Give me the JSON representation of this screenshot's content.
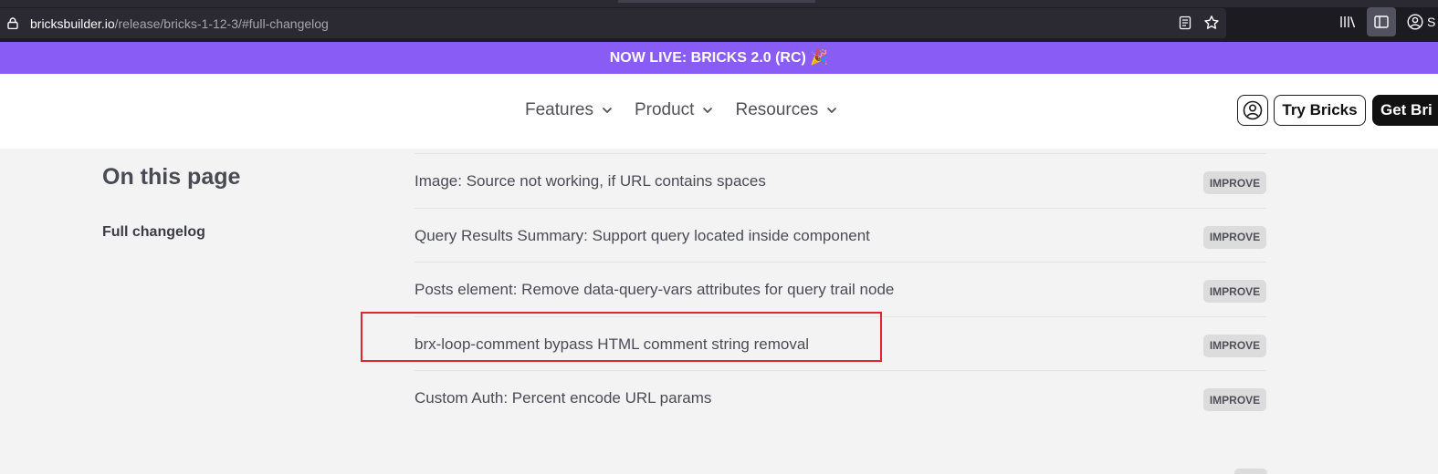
{
  "browser": {
    "url_domain": "bricksbuilder.io",
    "url_path": "/release/bricks-1-12-3/#full-changelog",
    "account_label": "S"
  },
  "announcement": {
    "text": "NOW LIVE: BRICKS 2.0 (RC) 🎉"
  },
  "nav": {
    "items": [
      {
        "label": "Features"
      },
      {
        "label": "Product"
      },
      {
        "label": "Resources"
      }
    ],
    "try_label": "Try Bricks",
    "get_label": "Get Bri"
  },
  "toc": {
    "title": "On this page",
    "link": "Full changelog"
  },
  "changelog": {
    "rows": [
      {
        "text": "Image: Source not working, if URL contains spaces",
        "badge": "IMPROVE"
      },
      {
        "text": "Query Results Summary: Support query located inside component",
        "badge": "IMPROVE"
      },
      {
        "text": "Posts element: Remove data-query-vars attributes for query trail node",
        "badge": "IMPROVE"
      },
      {
        "text": "brx-loop-comment bypass HTML comment string removal",
        "badge": "IMPROVE"
      },
      {
        "text": "Custom Auth: Percent encode URL params",
        "badge": "IMPROVE"
      }
    ]
  },
  "colors": {
    "announcement_bg": "#8a5cf6",
    "highlight": "#e0262d",
    "badge_bg": "#dcdcdc"
  }
}
